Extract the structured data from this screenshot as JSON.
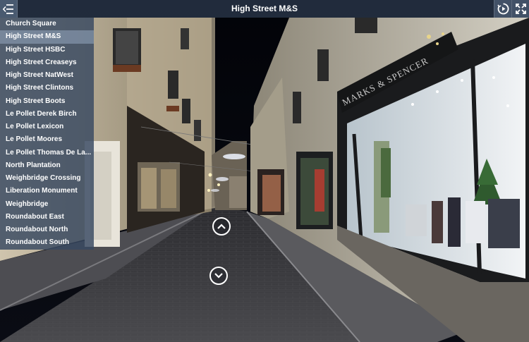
{
  "topbar": {
    "title": "High Street M&S"
  },
  "icons": {
    "menu": "list-menu-icon",
    "play": "play-circle-icon",
    "fullscreen": "fullscreen-icon",
    "up": "chevron-up-icon",
    "down": "chevron-down-icon"
  },
  "scenes": [
    {
      "label": "Church Square"
    },
    {
      "label": "High Street M&S",
      "active": true
    },
    {
      "label": "High Street HSBC"
    },
    {
      "label": "High Street Creaseys"
    },
    {
      "label": "High Street NatWest"
    },
    {
      "label": "High Street Clintons"
    },
    {
      "label": "High Street Boots"
    },
    {
      "label": "Le Pollet Derek Birch"
    },
    {
      "label": "Le Pollet Lexicon"
    },
    {
      "label": "Le Pollet Moores"
    },
    {
      "label": "Le Pollet Thomas De La..."
    },
    {
      "label": "North Plantation"
    },
    {
      "label": "Weighbridge Crossing"
    },
    {
      "label": "Liberation Monument"
    },
    {
      "label": "Weighbridge"
    },
    {
      "label": "Roundabout East"
    },
    {
      "label": "Roundabout North"
    },
    {
      "label": "Roundabout South"
    }
  ],
  "storefront": {
    "sign": "MARKS & SPENCER"
  },
  "colors": {
    "sky": "#05070c",
    "street": "#3a3a3e",
    "topbar": "#2e3c50",
    "list_active": "#96a8c0"
  }
}
